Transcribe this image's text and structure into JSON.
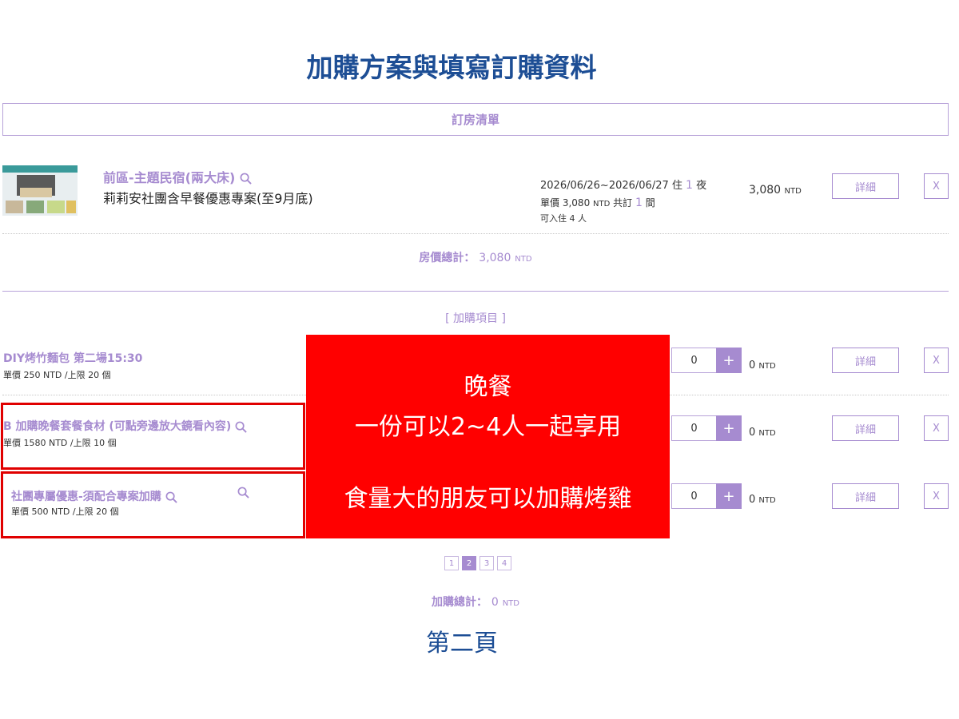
{
  "page_title": "加購方案與填寫訂購資料",
  "room_list": {
    "header": "訂房清單",
    "room": {
      "name": "前區-主題民宿(兩大床)",
      "plan": "莉莉安社團含早餐優惠專案(至9月底)",
      "date_range": "2026/06/26~2026/06/27",
      "stay_label": "住",
      "nights": "1",
      "nights_label": "夜",
      "unit_price_label": "單價",
      "unit_price": "3,080",
      "currency": "NTD",
      "booked_label": "共訂",
      "rooms_booked": "1",
      "rooms_label": "間",
      "capacity": "可入住 4 人",
      "line_total": "3,080",
      "detail_label": "詳細",
      "remove_label": "X"
    },
    "subtotal_label": "房價總計：",
    "subtotal_value": "3,080",
    "currency": "NTD"
  },
  "addons": {
    "title": "[ 加購項目 ]",
    "items": [
      {
        "name": "DIY烤竹麵包 第二場15:30",
        "meta": "單價 250 NTD /上限 20 個",
        "qty": "0",
        "plus": "+",
        "total": "0",
        "currency": "NTD",
        "detail_label": "詳細",
        "remove_label": "X"
      },
      {
        "name": "B 加購晚餐套餐食材 (可點旁邊放大鏡看內容)",
        "meta": "單價 1580 NTD /上限 10 個",
        "qty": "0",
        "plus": "+",
        "total": "0",
        "currency": "NTD",
        "detail_label": "詳細",
        "remove_label": "X"
      },
      {
        "name": "社團專屬優惠-須配合專案加購",
        "meta": "單價 500 NTD /上限 20 個",
        "qty": "0",
        "plus": "+",
        "total": "0",
        "currency": "NTD",
        "detail_label": "詳細",
        "remove_label": "X"
      }
    ],
    "pagination": [
      "1",
      "2",
      "3",
      "4"
    ],
    "active_page": "2",
    "total_label": "加購總計：",
    "total_value": "0",
    "currency": "NTD"
  },
  "overlay_note": {
    "line1": "晚餐",
    "line2": "一份可以2~4人一起享用",
    "line3": "食量大的朋友可以加購烤雞"
  },
  "page_note": "第二頁",
  "colors": {
    "title_blue": "#1d4e95",
    "accent_purple": "#a68bd0",
    "overlay_red": "#ff0000"
  }
}
